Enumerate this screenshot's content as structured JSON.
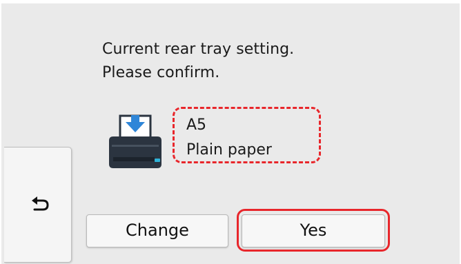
{
  "message": {
    "line1": "Current rear tray setting.",
    "line2": "Please confirm."
  },
  "paper": {
    "size": "A5",
    "type": "Plain paper"
  },
  "buttons": {
    "change_label": "Change",
    "yes_label": "Yes"
  },
  "icons": {
    "printer": "printer-rear-tray-icon",
    "back": "back-arrow-icon"
  },
  "colors": {
    "highlight": "#e8262b",
    "icon_blue": "#2f86d8",
    "printer_body": "#2b3440",
    "screen_bg": "#eaeaea"
  }
}
